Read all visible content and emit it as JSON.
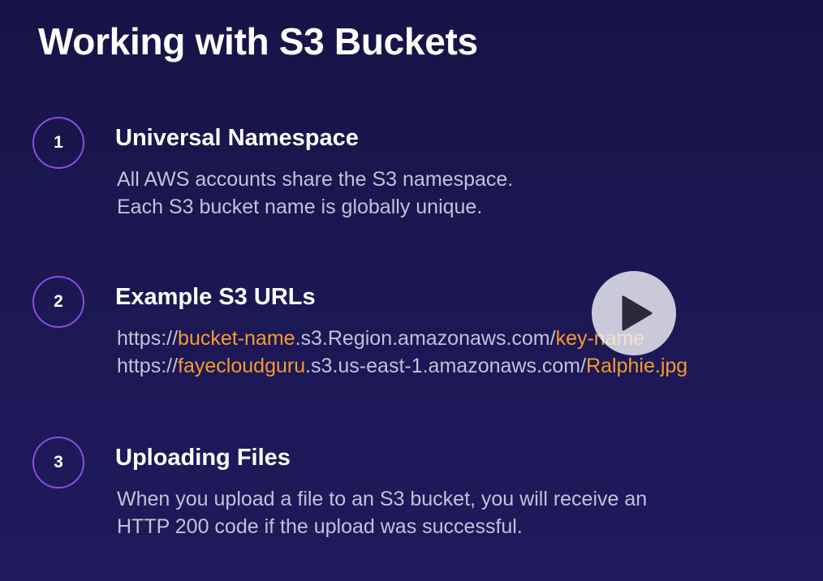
{
  "title": "Working with S3 Buckets",
  "colors": {
    "accent_ring": "#8a4fe0",
    "highlight": "#f39a2f",
    "body_text": "#c3c1d6",
    "background": "#1b1752"
  },
  "items": [
    {
      "number": "1",
      "title": "Universal Namespace",
      "lines": [
        "All AWS accounts share the S3 namespace.",
        "Each S3 bucket name is globally unique."
      ]
    },
    {
      "number": "2",
      "title": "Example S3 URLs",
      "url_1": {
        "prefix": "https://",
        "bucket": "bucket-name",
        "middle": ".s3.Region.amazonaws.com/",
        "key": "key-name"
      },
      "url_2": {
        "prefix": "https://",
        "bucket": "fayecloudguru",
        "middle": ".s3.us-east-1.amazonaws.com/",
        "key": "Ralphie.jpg"
      }
    },
    {
      "number": "3",
      "title": "Uploading Files",
      "lines": [
        "When you upload a file to an S3 bucket, you will receive an",
        "HTTP 200 code if the upload was successful."
      ]
    }
  ],
  "play_button": {
    "icon": "play-icon"
  }
}
